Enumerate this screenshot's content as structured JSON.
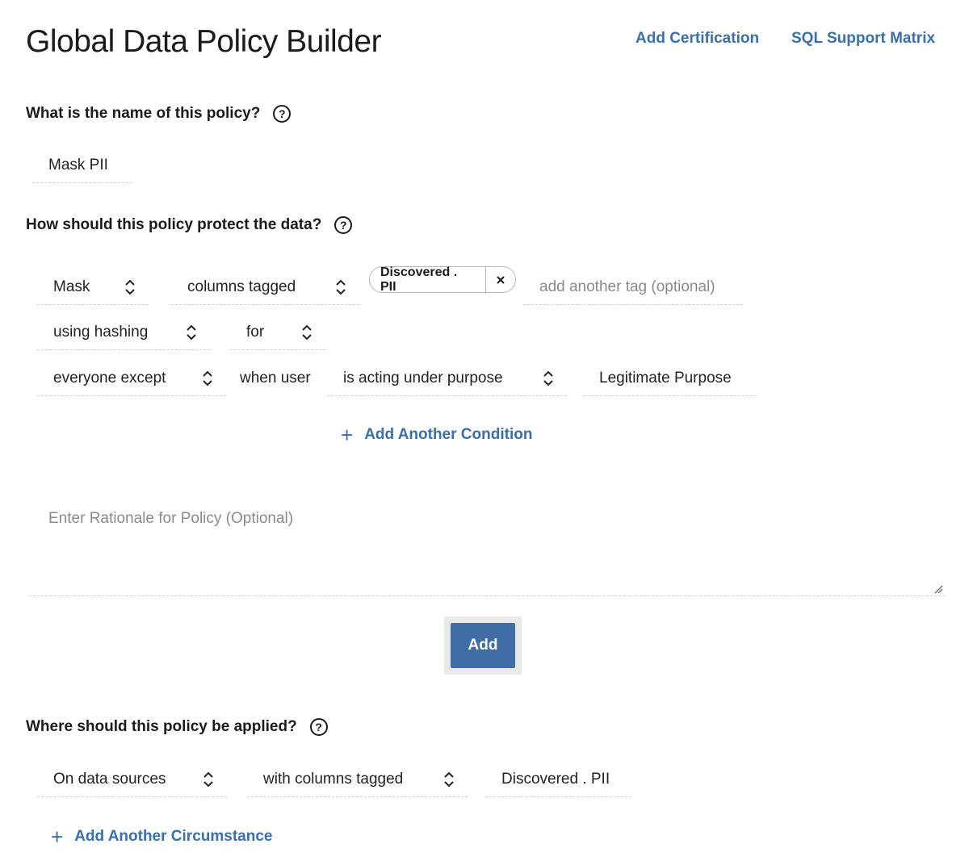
{
  "header": {
    "title": "Global Data Policy Builder",
    "add_certification": "Add Certification",
    "sql_support_matrix": "SQL Support Matrix"
  },
  "name_section": {
    "question": "What is the name of this policy?",
    "help_icon": "question-circle-icon",
    "policy_name": "Mask PII"
  },
  "protect_section": {
    "question": "How should this policy protect the data?",
    "help_icon": "question-circle-icon",
    "action": "Mask",
    "target": "columns tagged",
    "tag": "Discovered . PII",
    "tag_remove_icon": "close-icon",
    "tag_placeholder": "add another tag (optional)",
    "method": "using hashing",
    "for": "for",
    "scope": "everyone except",
    "when_user": "when user",
    "condition": "is acting under purpose",
    "purpose": "Legitimate Purpose",
    "add_condition": "Add Another Condition",
    "rationale_placeholder": "Enter Rationale for Policy (Optional)",
    "add_button": "Add"
  },
  "apply_section": {
    "question": "Where should this policy be applied?",
    "help_icon": "question-circle-icon",
    "sources": "On data sources",
    "filter": "with columns tagged",
    "tag_value": "Discovered . PII",
    "add_circumstance": "Add Another Circumstance"
  },
  "colors": {
    "link": "#3a6fa8",
    "primary_button": "#3f6ea6",
    "dashed_border": "#cfcfcf",
    "placeholder": "#8a8a8a"
  }
}
